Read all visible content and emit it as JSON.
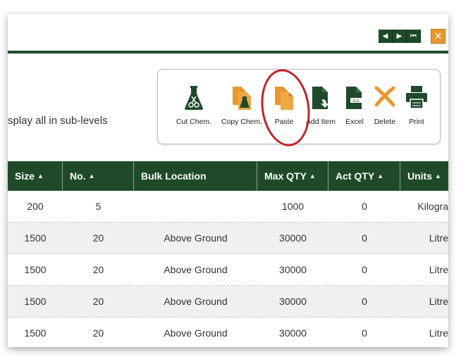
{
  "nav": {
    "prev": "◀",
    "next": "▶",
    "first": "⏮",
    "close": "✕"
  },
  "options": {
    "sublevel_text": "splay all in sub-levels"
  },
  "toolbar": {
    "items": [
      {
        "label": "Cut Chem."
      },
      {
        "label": "Copy Chem."
      },
      {
        "label": "Paste"
      },
      {
        "label": "Add Item"
      },
      {
        "label": "Excel"
      },
      {
        "label": "Delete"
      },
      {
        "label": "Print"
      }
    ]
  },
  "colors": {
    "header_bg": "#1f4a2a",
    "accent_orange": "#e8972f",
    "annotation_red": "#c42328"
  },
  "table": {
    "sort_glyph": "▲",
    "columns": [
      {
        "label": "Size",
        "sortable": true
      },
      {
        "label": "No.",
        "sortable": true
      },
      {
        "label": "Bulk Location",
        "sortable": false
      },
      {
        "label": "Max QTY",
        "sortable": true
      },
      {
        "label": "Act QTY",
        "sortable": true
      },
      {
        "label": "Units",
        "sortable": true
      }
    ],
    "rows": [
      [
        "200",
        "5",
        "",
        "1000",
        "0",
        "Kilogra"
      ],
      [
        "1500",
        "20",
        "Above Ground",
        "30000",
        "0",
        "Litre"
      ],
      [
        "1500",
        "20",
        "Above Ground",
        "30000",
        "0",
        "Litre"
      ],
      [
        "1500",
        "20",
        "Above Ground",
        "30000",
        "0",
        "Litre"
      ],
      [
        "1500",
        "20",
        "Above Ground",
        "30000",
        "0",
        "Litre"
      ]
    ]
  }
}
